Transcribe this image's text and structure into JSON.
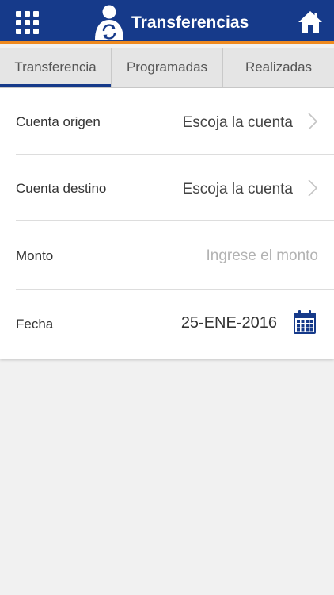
{
  "header": {
    "title": "Transferencias",
    "menu_icon": "grid-menu-icon",
    "logo_icon": "person-transfer-logo",
    "home_icon": "home-icon",
    "bg_color": "#163a8a",
    "accent_color": "#ef8a1f"
  },
  "tabs": [
    {
      "label": "Transferencia",
      "active": true
    },
    {
      "label": "Programadas",
      "active": false
    },
    {
      "label": "Realizadas",
      "active": false
    }
  ],
  "form": {
    "source_account": {
      "label": "Cuenta origen",
      "value": "Escoja la cuenta"
    },
    "destination_account": {
      "label": "Cuenta destino",
      "value": "Escoja la cuenta"
    },
    "amount": {
      "label": "Monto",
      "placeholder": "Ingrese el monto",
      "value": ""
    },
    "date": {
      "label": "Fecha",
      "value": "25-ENE-2016",
      "icon": "calendar-icon"
    }
  }
}
